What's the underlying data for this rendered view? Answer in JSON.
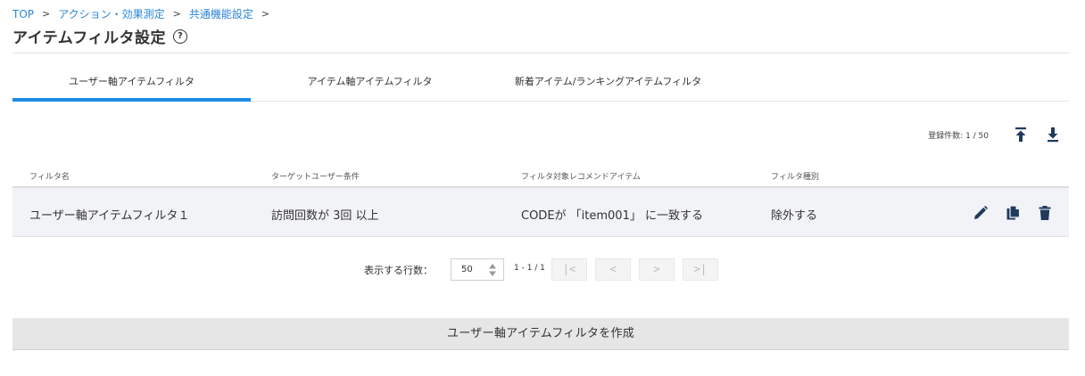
{
  "breadcrumb": {
    "items": [
      "TOP",
      "アクション・効果測定",
      "共通機能設定"
    ],
    "separator": ">"
  },
  "page": {
    "title": "アイテムフィルタ設定",
    "help_label": "?"
  },
  "tabs": [
    {
      "label": "ユーザー軸アイテムフィルタ",
      "active": true
    },
    {
      "label": "アイテム軸アイテムフィルタ",
      "active": false
    },
    {
      "label": "新着アイテム/ランキングアイテムフィルタ",
      "active": false
    }
  ],
  "list": {
    "count_label": "登録件数: 1 / 50",
    "columns": [
      "フィルタ名",
      "ターゲットユーザー条件",
      "フィルタ対象レコメンドアイテム",
      "フィルタ種別"
    ],
    "rows": [
      {
        "name": "ユーザー軸アイテムフィルタ１",
        "target": "訪問回数が 3回 以上",
        "item": "CODEが 「item001」 に一致する",
        "type": "除外する"
      }
    ]
  },
  "pagination": {
    "rows_label": "表示する行数：",
    "rows_value": "50",
    "range": "1 - 1 / 1",
    "first": "|<",
    "prev": "<",
    "next": ">",
    "last": ">|"
  },
  "create_button": "ユーザー軸アイテムフィルタを作成",
  "colors": {
    "accent": "#1e8be5",
    "link": "#2a86d6",
    "icon": "#1f3a5c"
  },
  "icons": [
    "help-icon",
    "upload-icon",
    "download-icon",
    "edit-icon",
    "copy-icon",
    "delete-icon",
    "spinner-arrows-icon"
  ]
}
